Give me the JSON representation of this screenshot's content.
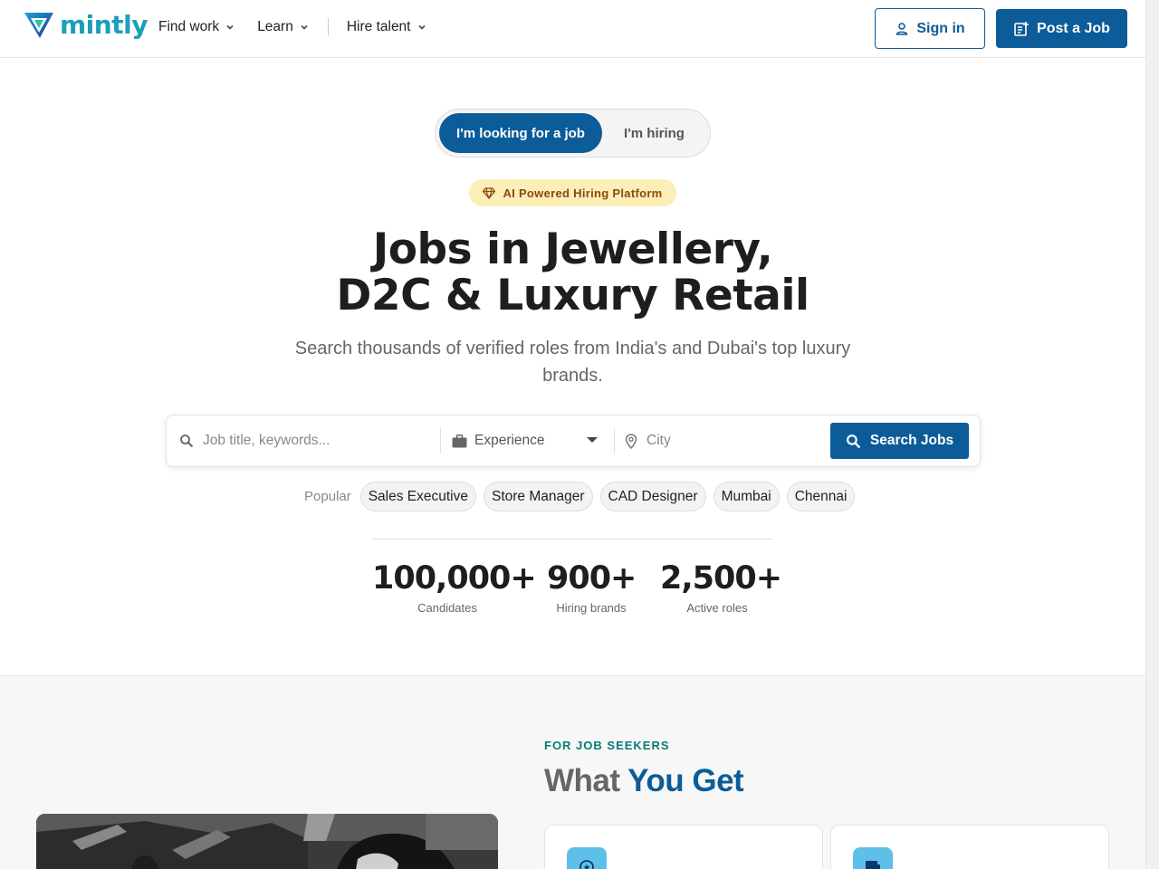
{
  "brand": {
    "name": "mintly",
    "logo_icon": "mintly-logo-icon"
  },
  "nav": {
    "items": [
      {
        "label": "Find work",
        "icon": "chevron-down-icon"
      },
      {
        "label": "Learn",
        "icon": "chevron-down-icon"
      },
      {
        "label": "Hire talent",
        "icon": "chevron-down-icon"
      }
    ],
    "sign_in": "Sign in",
    "post_job": "Post a Job"
  },
  "mode_toggle": {
    "active": "I'm looking for a job",
    "inactive": "I'm hiring"
  },
  "badge": "AI Powered Hiring Platform",
  "hero": {
    "title_line1": "Jobs in Jewellery,",
    "title_line2": "D2C & Luxury Retail",
    "subtitle": "Search thousands of verified roles from India's and Dubai's top luxury brands."
  },
  "search": {
    "keyword_placeholder": "Job title, keywords...",
    "experience_value": "Experience",
    "city_placeholder": "City",
    "button": "Search Jobs"
  },
  "popular": {
    "label": "Popular",
    "chips": [
      "Sales Executive",
      "Store Manager",
      "CAD Designer",
      "Mumbai",
      "Chennai"
    ]
  },
  "stats": [
    {
      "value": "100,000+",
      "caption": "Candidates"
    },
    {
      "value": "900+",
      "caption": "Hiring brands"
    },
    {
      "value": "2,500+",
      "caption": "Active roles"
    }
  ],
  "seekers": {
    "eyebrow": "FOR JOB SEEKERS",
    "title_part1": "What",
    "title_part2": "You Get"
  },
  "colors": {
    "primary": "#0b5c99",
    "teal": "#0a7b74",
    "badge_bg": "#fbeeb6",
    "badge_text": "#8a4a0c"
  }
}
